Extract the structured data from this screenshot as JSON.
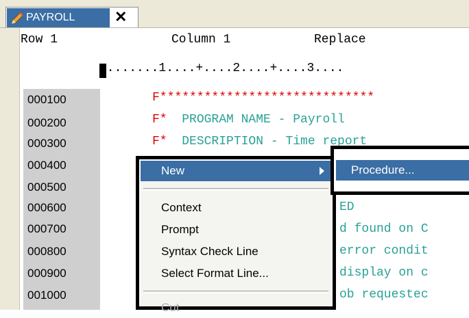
{
  "tab": {
    "title": "PAYROLL",
    "close": "✕"
  },
  "status": {
    "row": "Row 1",
    "column": "Column 1",
    "mode": "Replace"
  },
  "ruler": "........1....+....2....+....3....",
  "lines": [
    {
      "num": "000100",
      "code": "F*****************************",
      "color": "red"
    },
    {
      "num": "000200",
      "code": "F*  PROGRAM NAME - Payroll",
      "color": "mixed"
    },
    {
      "num": "000300",
      "code": "F*  DESCRIPTION - Time report",
      "color": "mixed"
    },
    {
      "num": "000400",
      "code": ""
    },
    {
      "num": "000500",
      "code": ""
    },
    {
      "num": "000600",
      "code": "ED"
    },
    {
      "num": "000700",
      "code": "d found on C"
    },
    {
      "num": "000800",
      "code": "error condit"
    },
    {
      "num": "000900",
      "code": "display on c"
    },
    {
      "num": "001000",
      "code": "ob requestec"
    }
  ],
  "context_menu": {
    "items": [
      "New",
      "Context",
      "Prompt",
      "Syntax Check Line",
      "Select Format Line...",
      "Cut"
    ]
  },
  "submenu": {
    "items": [
      "Procedure..."
    ]
  },
  "colors": {
    "highlight": "#3a6ea5",
    "keyword_red": "#e00000",
    "code_teal": "#2aa198"
  }
}
